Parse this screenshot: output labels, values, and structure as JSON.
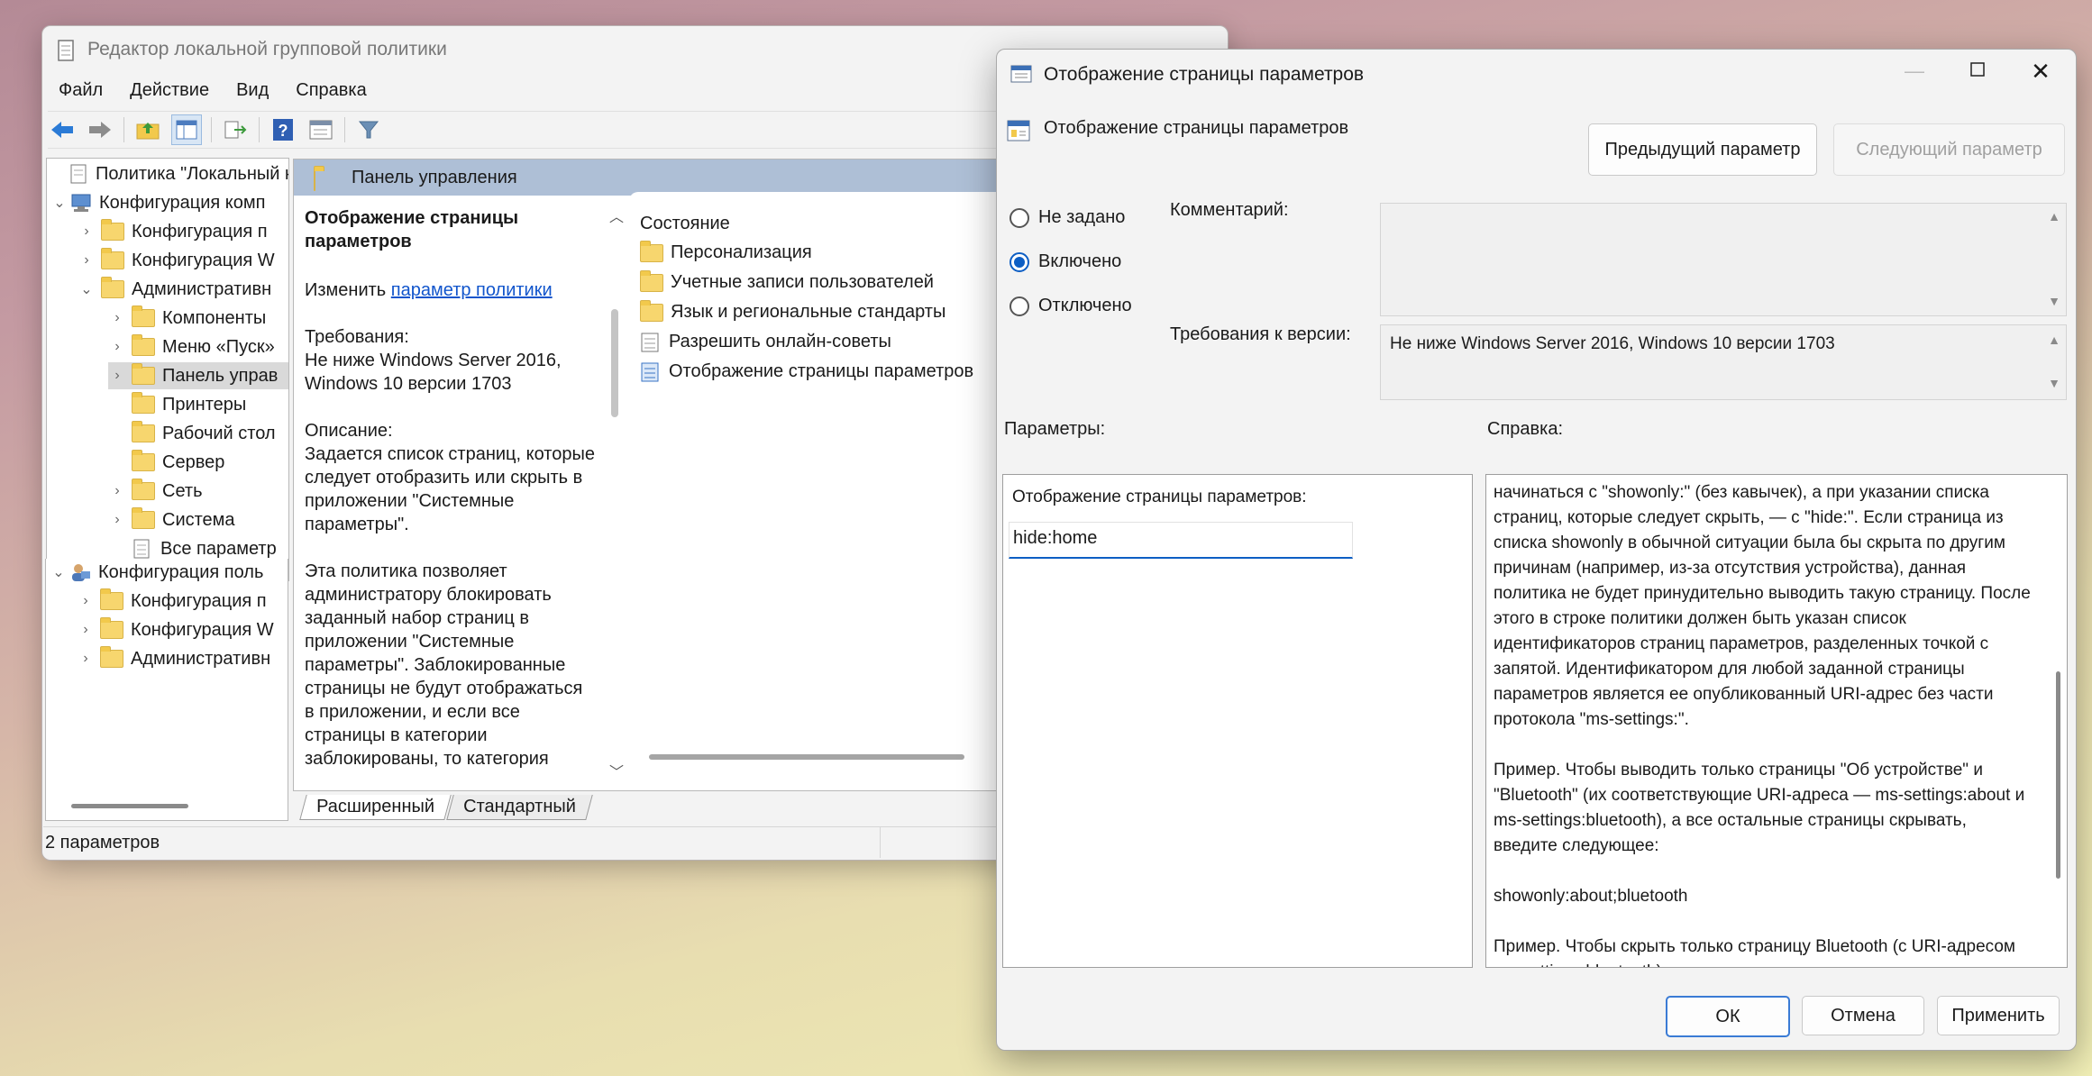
{
  "main_window": {
    "title": "Редактор локальной групповой политики",
    "menu": [
      "Файл",
      "Действие",
      "Вид",
      "Справка"
    ],
    "tree": [
      {
        "label": "Политика \"Локальный к",
        "level": 0,
        "chevron": ""
      },
      {
        "label": "Конфигурация комп",
        "level": 0,
        "chevron": "⌄"
      },
      {
        "label": "Конфигурация п",
        "level": 1,
        "chevron": "›"
      },
      {
        "label": "Конфигурация W",
        "level": 1,
        "chevron": "›"
      },
      {
        "label": "Административн",
        "level": 1,
        "chevron": "⌄"
      },
      {
        "label": "Компоненты",
        "level": 2,
        "chevron": "›"
      },
      {
        "label": "Меню «Пуск»",
        "level": 2,
        "chevron": "›"
      },
      {
        "label": "Панель управ",
        "level": 2,
        "chevron": "›"
      },
      {
        "label": "Принтеры",
        "level": 2,
        "chevron": ""
      },
      {
        "label": "Рабочий стол",
        "level": 2,
        "chevron": "›"
      },
      {
        "label": "Сервер",
        "level": 2,
        "chevron": ""
      },
      {
        "label": "Сеть",
        "level": 2,
        "chevron": "›"
      },
      {
        "label": "Система",
        "level": 2,
        "chevron": "›"
      },
      {
        "label": "Все параметр",
        "level": 2,
        "chevron": ""
      },
      {
        "label": "Конфигурация поль",
        "level": 0,
        "chevron": "⌄"
      },
      {
        "label": "Конфигурация п",
        "level": 1,
        "chevron": "›"
      },
      {
        "label": "Конфигурация W",
        "level": 1,
        "chevron": "›"
      },
      {
        "label": "Административн",
        "level": 1,
        "chevron": "›"
      }
    ],
    "content_header": "Панель управления",
    "description": {
      "title": "Отображение страницы параметров",
      "edit_prefix": "Изменить ",
      "edit_link": "параметр политики",
      "req_label": "Требования:",
      "req_text": "Не ниже Windows Server 2016, Windows 10 версии 1703",
      "desc_label": "Описание:",
      "desc_text": "Задается список страниц, которые следует отобразить или скрыть в приложении \"Системные параметры\".",
      "desc_text2": "Эта политика позволяет администратору блокировать заданный набор страниц в приложении \"Системные параметры\". Заблокированные страницы не будут отображаться в приложении, и если все страницы в категории заблокированы, то категория"
    },
    "list_header": "Состояние",
    "list_items": [
      {
        "label": "Персонализация",
        "icon": "folder-icon"
      },
      {
        "label": "Учетные записи пользователей",
        "icon": "folder-icon"
      },
      {
        "label": "Язык и региональные стандарты",
        "icon": "folder-icon"
      },
      {
        "label": "Разрешить онлайн-советы",
        "icon": "setting-icon"
      },
      {
        "label": "Отображение страницы параметров",
        "icon": "setting-icon"
      }
    ],
    "tabs": [
      "Расширенный",
      "Стандартный"
    ],
    "status": "2 параметров"
  },
  "dialog": {
    "title": "Отображение страницы параметров",
    "policy_name": "Отображение страницы параметров",
    "prev_button": "Предыдущий параметр",
    "next_button": "Следующий параметр",
    "radio_options": [
      {
        "label": "Не задано",
        "checked": false
      },
      {
        "label": "Включено",
        "checked": true
      },
      {
        "label": "Отключено",
        "checked": false
      }
    ],
    "comment_label": "Комментарий:",
    "version_label": "Требования к версии:",
    "version_text": "Не ниже Windows Server 2016, Windows 10 версии 1703",
    "params_label": "Параметры:",
    "help_label": "Справка:",
    "param_field_label": "Отображение страницы параметров:",
    "param_field_value": "hide:home",
    "help_paragraphs": [
      "начинаться с \"showonly:\" (без кавычек), а при указании списка страниц, которые следует скрыть, — с \"hide:\". Если страница из списка showonly в обычной ситуации была бы скрыта по другим причинам (например, из-за отсутствия устройства), данная политика не будет принудительно выводить такую страницу. После этого в строке политики должен быть указан список идентификаторов страниц параметров, разделенных точкой с запятой. Идентификатором для любой заданной страницы параметров является ее опубликованный URI-адрес без части протокола \"ms-settings:\".",
      "Пример. Чтобы выводить только страницы \"Об устройстве\" и \"Bluetooth\" (их соответствующие URI-адреса — ms-settings:about и ms-settings:bluetooth), а все остальные страницы скрывать, введите следующее:",
      "showonly:about;bluetooth",
      "Пример. Чтобы скрыть только страницу Bluetooth (с URI-адресом ms-settings:bluetooth), введите следующее:"
    ],
    "ok_button": "ОК",
    "cancel_button": "Отмена",
    "apply_button": "Применить"
  }
}
